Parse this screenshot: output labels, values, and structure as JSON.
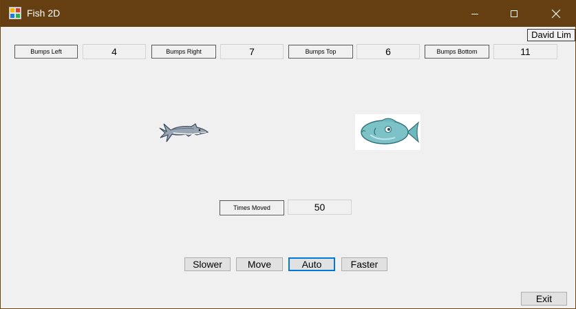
{
  "window": {
    "title": "Fish 2D",
    "title_bar_color": "#653f11"
  },
  "author": "David Lim",
  "counters": [
    {
      "label": "Bumps Left",
      "value": "4"
    },
    {
      "label": "Bumps Right",
      "value": "7"
    },
    {
      "label": "Bumps Top",
      "value": "6"
    },
    {
      "label": "Bumps Bottom",
      "value": "11"
    }
  ],
  "times_moved": {
    "label": "Times Moved",
    "value": "50"
  },
  "sprites": [
    "shark-image",
    "fish-image"
  ],
  "buttons": {
    "slower": "Slower",
    "move": "Move",
    "auto": "Auto",
    "faster": "Faster",
    "exit": "Exit"
  },
  "focus_color": "#0078d7"
}
